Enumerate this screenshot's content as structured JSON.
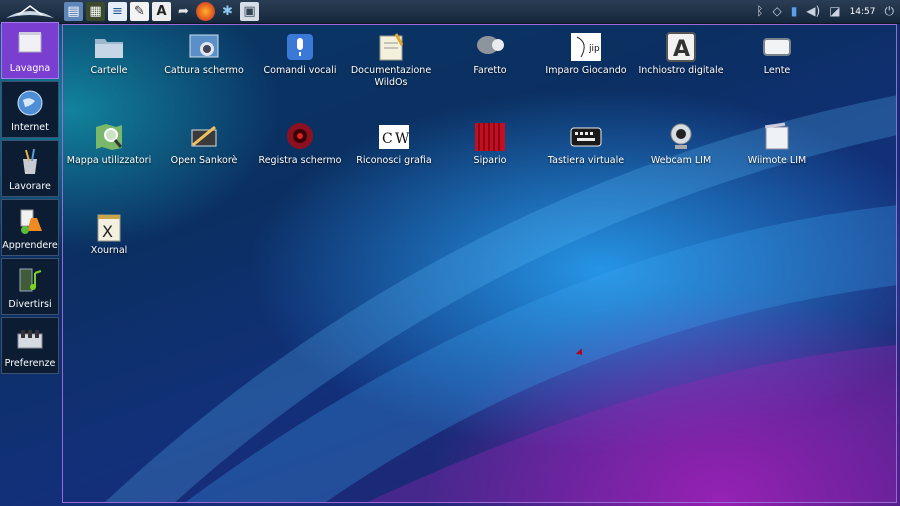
{
  "topbar": {
    "launchers": [
      "file-manager-icon",
      "terminal-icon",
      "document-icon",
      "text-editor-icon",
      "font-a-icon",
      "share-icon",
      "firefox-icon",
      "settings-star-icon",
      "screenshot-icon"
    ],
    "clock": "14:57"
  },
  "dock": {
    "items": [
      {
        "label": "Lavagna",
        "icon": "whiteboard-icon",
        "active": true
      },
      {
        "label": "Internet",
        "icon": "globe-icon"
      },
      {
        "label": "Lavorare",
        "icon": "pencils-icon"
      },
      {
        "label": "Apprendere",
        "icon": "flask-icon"
      },
      {
        "label": "Divertirsi",
        "icon": "film-music-icon"
      },
      {
        "label": "Preferenze",
        "icon": "preferences-icon"
      }
    ]
  },
  "desktop": {
    "icons": [
      {
        "label": "Cartelle",
        "icon": "folder-icon"
      },
      {
        "label": "Cattura schermo",
        "icon": "camera-icon"
      },
      {
        "label": "Comandi vocali",
        "icon": "microphone-icon"
      },
      {
        "label": "Documentazione WildOs",
        "icon": "notepad-icon"
      },
      {
        "label": "Faretto",
        "icon": "spotlight-icon"
      },
      {
        "label": "Imparo Giocando",
        "icon": "face-drawing-icon"
      },
      {
        "label": "Inchiostro digitale",
        "icon": "letter-a-icon"
      },
      {
        "label": "Lente",
        "icon": "lens-icon"
      },
      {
        "label": "Mappa utilizzatori",
        "icon": "map-magnifier-icon"
      },
      {
        "label": "Open Sankorè",
        "icon": "pen-board-icon"
      },
      {
        "label": "Registra schermo",
        "icon": "record-icon"
      },
      {
        "label": "Riconosci grafia",
        "icon": "handwriting-icon"
      },
      {
        "label": "Sipario",
        "icon": "curtain-icon"
      },
      {
        "label": "Tastiera virtuale",
        "icon": "keyboard-icon"
      },
      {
        "label": "Webcam LIM",
        "icon": "webcam-icon"
      },
      {
        "label": "Wiimote LIM",
        "icon": "wiimote-icon"
      },
      {
        "label": "Xournal",
        "icon": "xournal-icon"
      }
    ]
  }
}
